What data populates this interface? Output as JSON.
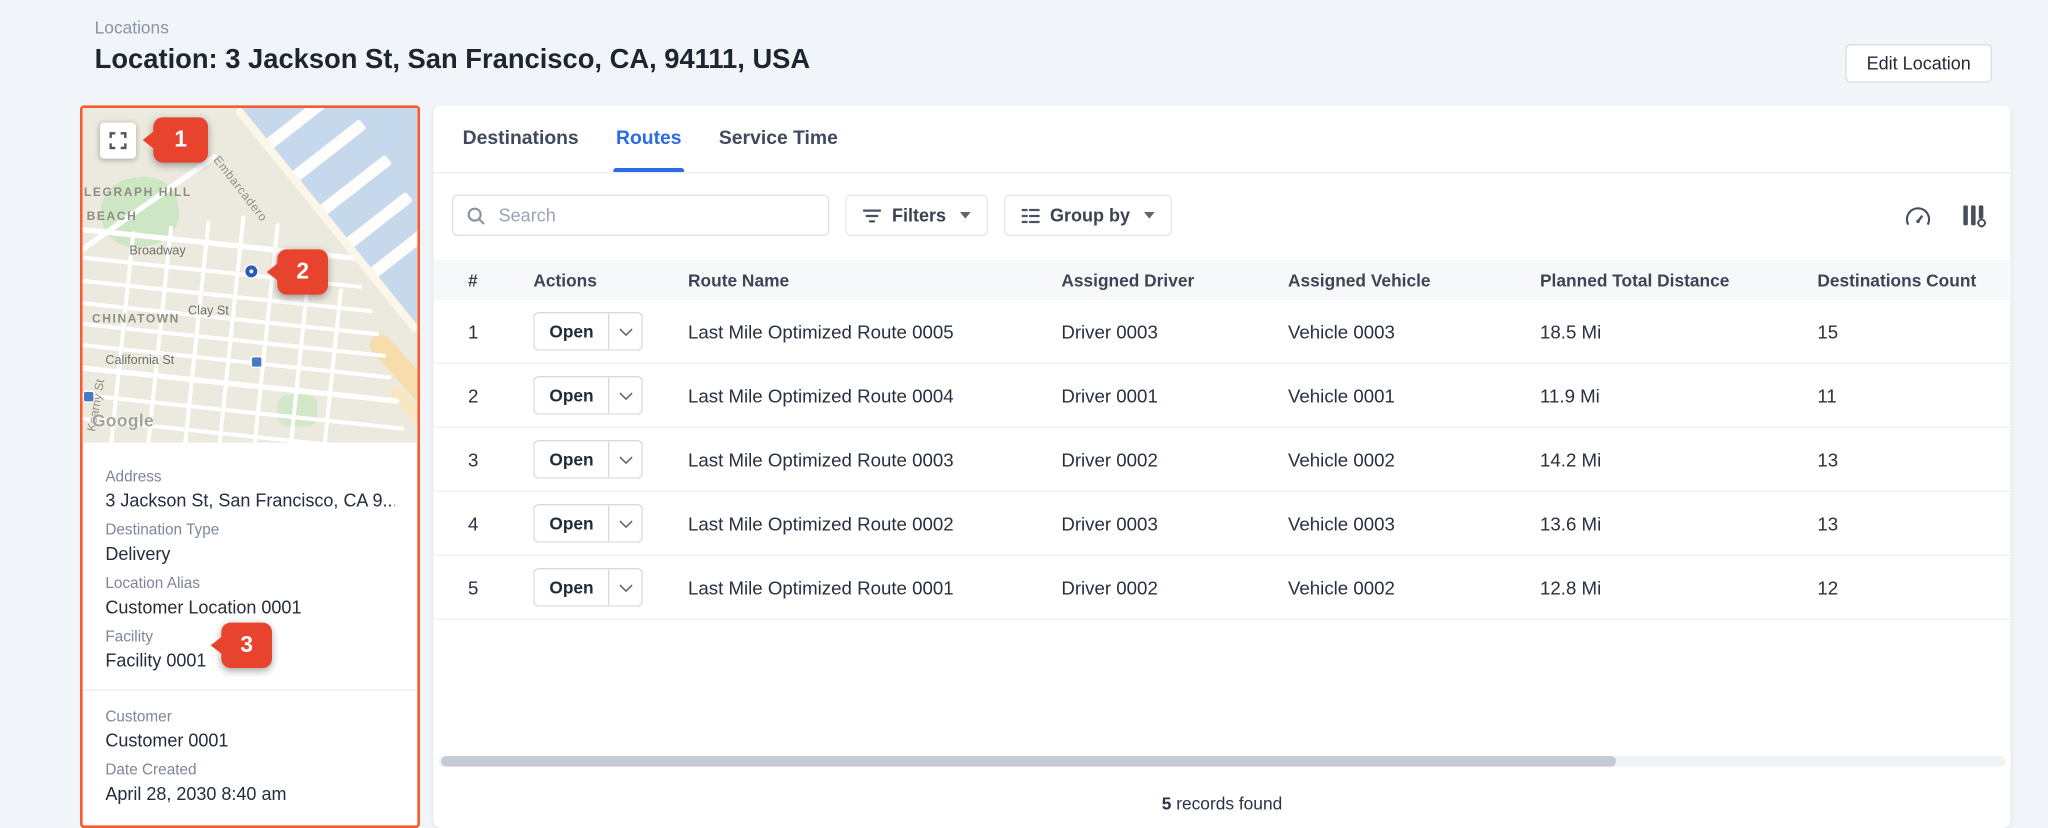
{
  "header": {
    "breadcrumb": "Locations",
    "title": "Location: 3 Jackson St, San Francisco, CA, 94111, USA",
    "edit_button": "Edit Location"
  },
  "annotations": {
    "badge1": "1",
    "badge2": "2",
    "badge3": "3"
  },
  "map": {
    "labels": {
      "district1": "LEGRAPH HILL",
      "district2": "BEACH",
      "district3": "CHINATOWN",
      "street_broadway": "Broadway",
      "street_clay": "Clay St",
      "street_california": "California St",
      "street_kearny": "Kearny St",
      "shore": "Embarcadero"
    },
    "attribution": "Google"
  },
  "details": {
    "primary": [
      {
        "label": "Address",
        "value": "3 Jackson St, San Francisco, CA 9..."
      },
      {
        "label": "Destination Type",
        "value": "Delivery"
      },
      {
        "label": "Location Alias",
        "value": "Customer Location 0001"
      },
      {
        "label": "Facility",
        "value": "Facility 0001"
      }
    ],
    "secondary": [
      {
        "label": "Customer",
        "value": "Customer 0001"
      },
      {
        "label": "Date Created",
        "value": "April 28, 2030 8:40 am"
      }
    ]
  },
  "tabs": [
    {
      "label": "Destinations",
      "active": false
    },
    {
      "label": "Routes",
      "active": true
    },
    {
      "label": "Service Time",
      "active": false
    }
  ],
  "toolbar": {
    "search_placeholder": "Search",
    "filters": "Filters",
    "group_by": "Group by"
  },
  "table": {
    "columns": [
      "#",
      "Actions",
      "Route Name",
      "Assigned Driver",
      "Assigned Vehicle",
      "Planned Total Distance",
      "Destinations Count"
    ],
    "action_label": "Open",
    "rows": [
      {
        "num": "1",
        "route": "Last Mile Optimized Route 0005",
        "driver": "Driver 0003",
        "vehicle": "Vehicle 0003",
        "distance": "18.5 Mi",
        "count": "15"
      },
      {
        "num": "2",
        "route": "Last Mile Optimized Route 0004",
        "driver": "Driver 0001",
        "vehicle": "Vehicle 0001",
        "distance": "11.9 Mi",
        "count": "11"
      },
      {
        "num": "3",
        "route": "Last Mile Optimized Route 0003",
        "driver": "Driver 0002",
        "vehicle": "Vehicle 0002",
        "distance": "14.2 Mi",
        "count": "13"
      },
      {
        "num": "4",
        "route": "Last Mile Optimized Route 0002",
        "driver": "Driver 0003",
        "vehicle": "Vehicle 0003",
        "distance": "13.6 Mi",
        "count": "13"
      },
      {
        "num": "5",
        "route": "Last Mile Optimized Route 0001",
        "driver": "Driver 0002",
        "vehicle": "Vehicle 0002",
        "distance": "12.8 Mi",
        "count": "12"
      }
    ]
  },
  "footer": {
    "count": "5",
    "text": " records found"
  },
  "colors": {
    "accent_blue": "#2b6be6",
    "annotation_red": "#e8432d",
    "highlight_border_orange": "#f95b2e",
    "page_background": "#f1f4f8"
  }
}
